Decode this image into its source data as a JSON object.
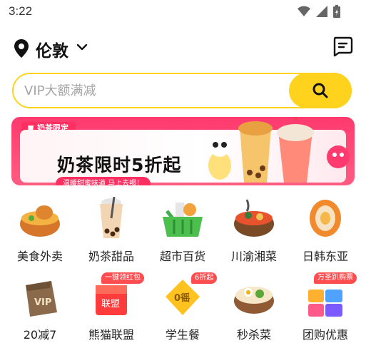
{
  "status_bar": {
    "time": "3:22"
  },
  "header": {
    "city": "伦敦"
  },
  "search": {
    "placeholder": "VIP大额满减"
  },
  "banner": {
    "tag": "奶茶限定",
    "title": "奶茶限时5折起",
    "subtitle": "温暖甜蜜味道 马上去喝！"
  },
  "categories": [
    {
      "label": "美食外卖",
      "icon": "food-bowl-icon"
    },
    {
      "label": "奶茶甜品",
      "icon": "bubble-tea-icon"
    },
    {
      "label": "超市百货",
      "icon": "grocery-basket-icon"
    },
    {
      "label": "川渝湘菜",
      "icon": "hotpot-bowl-icon"
    },
    {
      "label": "日韩东亚",
      "icon": "sushi-icon"
    },
    {
      "label": "20减7",
      "icon": "vip-bag-icon",
      "badge": ""
    },
    {
      "label": "熊猫联盟",
      "icon": "panda-league-icon",
      "badge": "一键领红包"
    },
    {
      "label": "学生餐",
      "icon": "student-meal-icon",
      "badge": "6折起"
    },
    {
      "label": "秒杀菜",
      "icon": "flash-sale-dish-icon",
      "badge": ""
    },
    {
      "label": "团购优惠",
      "icon": "group-buy-icon",
      "badge": "万圣趴购票"
    }
  ],
  "colors": {
    "accent": "#ffd21e",
    "promo": "#ff2f62",
    "badge": "#ff4d4f"
  }
}
